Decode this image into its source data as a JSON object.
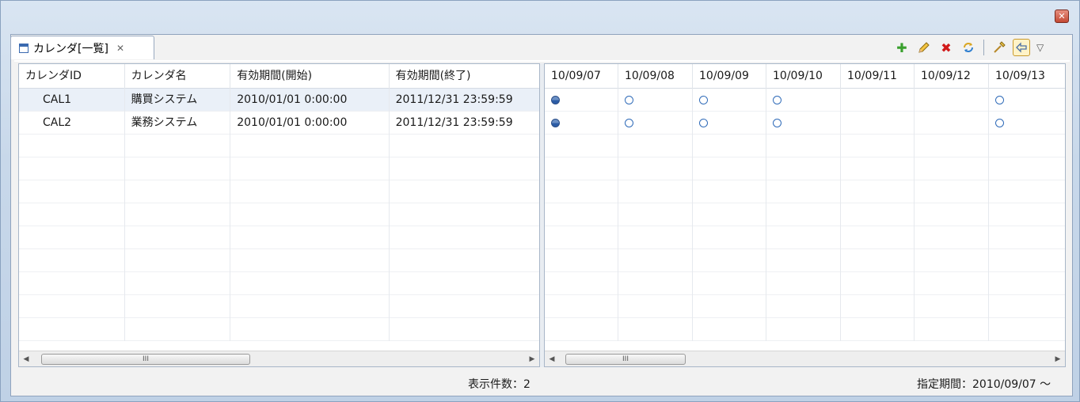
{
  "window": {
    "close_glyph": "✕"
  },
  "tab": {
    "title": "カレンダ[一覧]",
    "close_glyph": "✕"
  },
  "toolbar": {
    "add_icon": "plus-icon",
    "edit_icon": "pencil-icon",
    "delete_icon": "delete-icon",
    "refresh_icon": "refresh-icon",
    "filter_icon": "filter-icon",
    "back_icon": "back-arrow-icon",
    "add_color": "#3aa02e",
    "delete_color": "#d11a1a"
  },
  "calendar_list": {
    "columns": [
      "カレンダID",
      "カレンダ名",
      "有効期間(開始)",
      "有効期間(終了)"
    ],
    "rows": [
      {
        "id": "CAL1",
        "name": "購買システム",
        "start": "2010/01/01 0:00:00",
        "end": "2011/12/31 23:59:59"
      },
      {
        "id": "CAL2",
        "name": "業務システム",
        "start": "2010/01/01 0:00:00",
        "end": "2011/12/31 23:59:59"
      }
    ]
  },
  "schedule": {
    "dates": [
      "10/09/07",
      "10/09/08",
      "10/09/09",
      "10/09/10",
      "10/09/11",
      "10/09/12",
      "10/09/13"
    ],
    "rows": [
      [
        "filled",
        "empty",
        "empty",
        "empty",
        "",
        "",
        "empty"
      ],
      [
        "filled",
        "empty",
        "empty",
        "empty",
        "",
        "",
        "empty"
      ]
    ]
  },
  "scroll_grip": "III",
  "status": {
    "count_text": "表示件数：2",
    "period_text": "指定期間：2010/09/07 ～"
  }
}
